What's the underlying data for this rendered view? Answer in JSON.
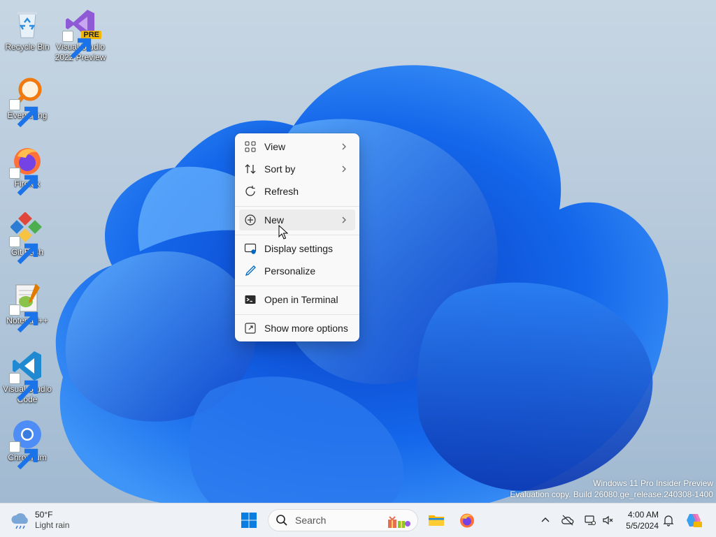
{
  "desktop": {
    "icons": [
      {
        "label": "Recycle Bin",
        "icon": "recycle-bin-icon"
      },
      {
        "label": "Visual Studio 2022 Preview",
        "icon": "visual-studio-icon",
        "badge": "PRE"
      },
      {
        "label": "Everything",
        "icon": "everything-icon"
      },
      {
        "label": "Firefox",
        "icon": "firefox-icon"
      },
      {
        "label": "Git Bash",
        "icon": "git-bash-icon"
      },
      {
        "label": "Notepad++",
        "icon": "notepad-plus-plus-icon"
      },
      {
        "label": "Visual Studio Code",
        "icon": "vscode-icon"
      },
      {
        "label": "Chromium",
        "icon": "chromium-icon"
      }
    ]
  },
  "context_menu": {
    "items": [
      {
        "label": "View",
        "icon": "grid-view-icon",
        "submenu": true
      },
      {
        "label": "Sort by",
        "icon": "sort-icon",
        "submenu": true
      },
      {
        "label": "Refresh",
        "icon": "refresh-icon",
        "submenu": false
      },
      {
        "label": "New",
        "icon": "plus-circle-icon",
        "submenu": true,
        "highlighted": true
      },
      {
        "label": "Display settings",
        "icon": "display-settings-icon",
        "submenu": false
      },
      {
        "label": "Personalize",
        "icon": "pen-icon",
        "submenu": false
      },
      {
        "label": "Open in Terminal",
        "icon": "terminal-icon",
        "submenu": false
      },
      {
        "label": "Show more options",
        "icon": "more-options-icon",
        "submenu": false
      }
    ]
  },
  "watermark": {
    "line1": "Windows 11 Pro Insider Preview",
    "line2": "Evaluation copy. Build 26080.ge_release.240308-1400"
  },
  "taskbar": {
    "weather": {
      "temp": "50°F",
      "condition": "Light rain",
      "icon": "cloud-rain-icon"
    },
    "search": {
      "placeholder": "Search"
    },
    "clock": {
      "time": "4:00 AM",
      "date": "5/5/2024"
    }
  },
  "colors": {
    "accent": "#0067c0",
    "wallpaper_blue": "#1a5fe0",
    "menu_bg": "#f9f9f9",
    "taskbar_bg": "#eef1f5"
  }
}
